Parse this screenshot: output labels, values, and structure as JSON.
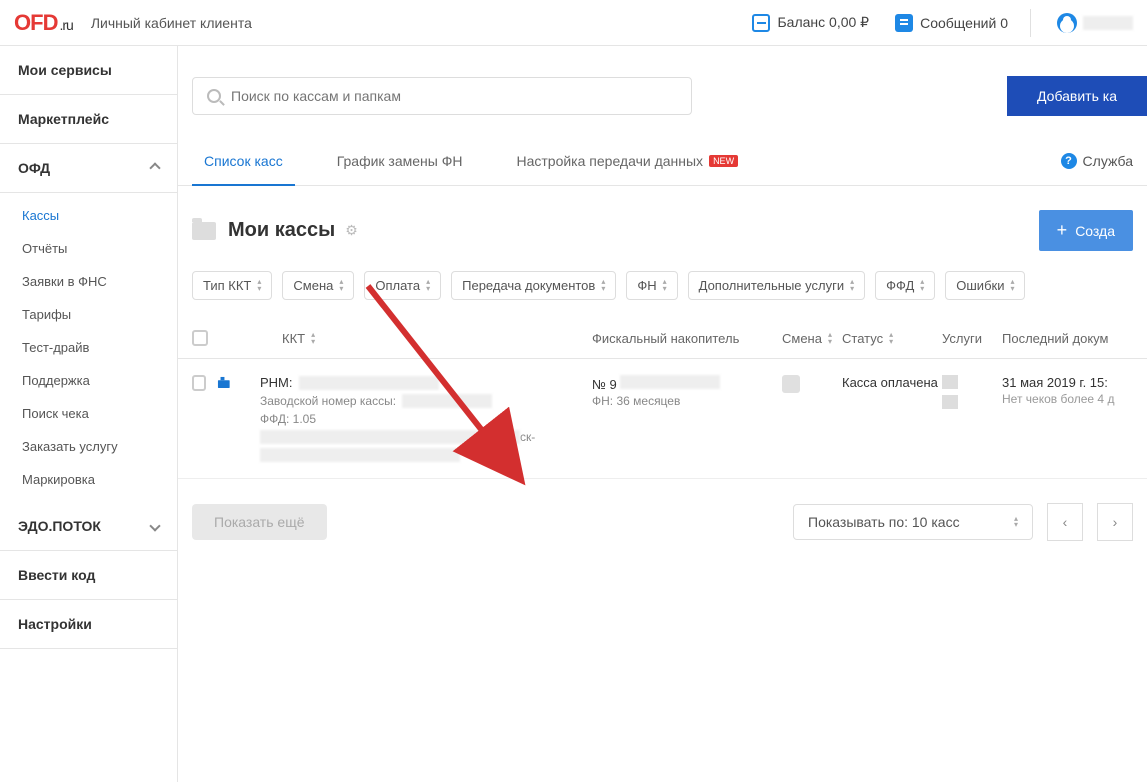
{
  "header": {
    "logo_ru": ".ru",
    "app_title": "Личный кабинет клиента",
    "balance_label": "Баланс 0,00 ₽",
    "messages_label": "Сообщений 0"
  },
  "sidebar": {
    "my_services": "Мои сервисы",
    "marketplace": "Маркетплейс",
    "ofd": "ОФД",
    "ofd_items": {
      "kassy": "Кассы",
      "reports": "Отчёты",
      "fns": "Заявки в ФНС",
      "tariffs": "Тарифы",
      "test_drive": "Тест-драйв",
      "support": "Поддержка",
      "search_check": "Поиск чека",
      "order_service": "Заказать услугу",
      "marking": "Маркировка"
    },
    "edo": "ЭДО.ПОТОК",
    "enter_code": "Ввести код",
    "settings": "Настройки"
  },
  "search": {
    "placeholder": "Поиск по кассам и папкам"
  },
  "buttons": {
    "add_kassa": "Добавить ка",
    "create_folder": "Созда",
    "show_more": "Показать ещё"
  },
  "tabs": {
    "list": "Список касс",
    "fn_schedule": "График замены ФН",
    "data_transfer": "Настройка передачи данных",
    "new_badge": "NEW",
    "help": "Служба"
  },
  "section": {
    "title": "Мои кассы"
  },
  "filters": {
    "kkt_type": "Тип ККТ",
    "shift": "Смена",
    "payment": "Оплата",
    "doc_transfer": "Передача документов",
    "fn": "ФН",
    "extra_services": "Дополнительные услуги",
    "ffd": "ФФД",
    "errors": "Ошибки"
  },
  "table": {
    "headers": {
      "kkt": "ККТ",
      "fn": "Фискальный накопитель",
      "shift": "Смена",
      "status": "Статус",
      "services": "Услуги",
      "last_doc": "Последний докум"
    },
    "row1": {
      "rnm_label": "РНМ:",
      "factory_label": "Заводской номер кассы:",
      "ffd": "ФФД: 1.05",
      "fn_no_prefix": "№ 9",
      "fn_months": "ФН: 36 месяцев",
      "status": "Касса оплачена",
      "last_doc": "31 мая 2019 г. 15:",
      "no_checks": "Нет чеков более 4 д"
    }
  },
  "footer": {
    "per_page": "Показывать по: 10 касс"
  }
}
